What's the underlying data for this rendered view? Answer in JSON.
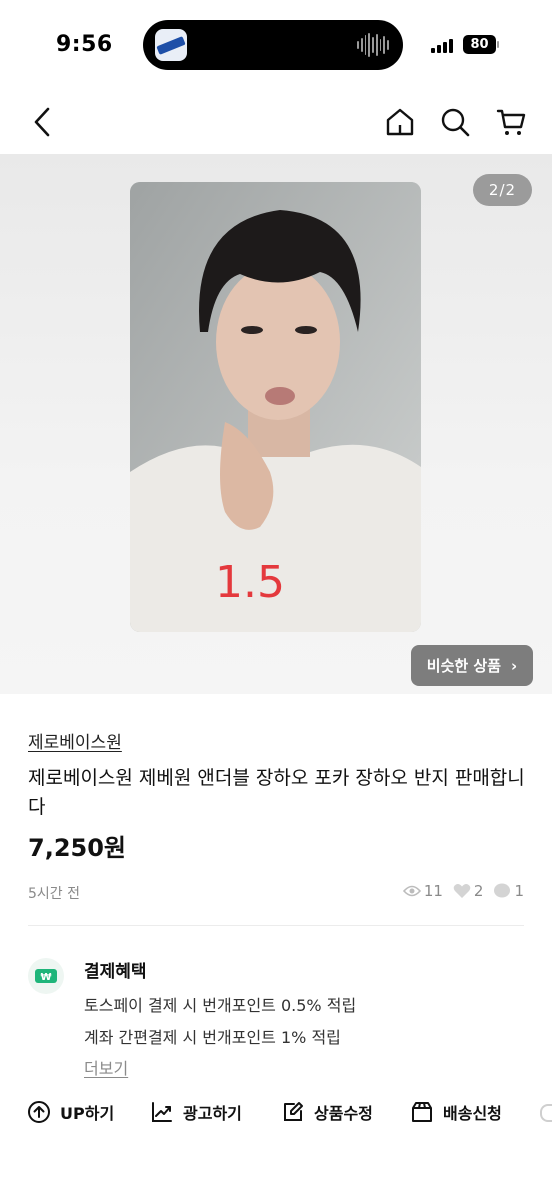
{
  "status_bar": {
    "time": "9:56",
    "battery": "80"
  },
  "nav": {
    "back_icon": "chevron-left-icon",
    "home_icon": "home-icon",
    "search_icon": "search-icon",
    "cart_icon": "cart-icon"
  },
  "gallery": {
    "counter": "2/2",
    "handwritten_price": "1.5",
    "similar_button": "비슷한 상품",
    "similar_chevron": "›"
  },
  "product": {
    "store": "제로베이스원",
    "title": "제로베이스원 제베원 앤더블 장하오 포카 장하오 반지 판매합니다",
    "price": "7,250원",
    "posted": "5시간 전",
    "views": "11",
    "likes": "2",
    "chats": "1"
  },
  "benefits": {
    "title": "결제혜택",
    "line1": "토스페이 결제 시 번개포인트 0.5% 적립",
    "line2": "계좌 간편결제 시 번개포인트 1% 적립",
    "more": "더보기",
    "icon_label": "₩"
  },
  "actions": [
    {
      "label": "UP하기",
      "icon": "arrow-up-circle-icon"
    },
    {
      "label": "광고하기",
      "icon": "trend-chart-icon"
    },
    {
      "label": "상품수정",
      "icon": "edit-icon"
    },
    {
      "label": "배송신청",
      "icon": "box-icon"
    }
  ],
  "colors": {
    "accent_green": "#1fb57a",
    "badge_gray": "#9b9b9b",
    "button_gray": "#7d7d7d",
    "text_muted": "#8a8a8a"
  }
}
